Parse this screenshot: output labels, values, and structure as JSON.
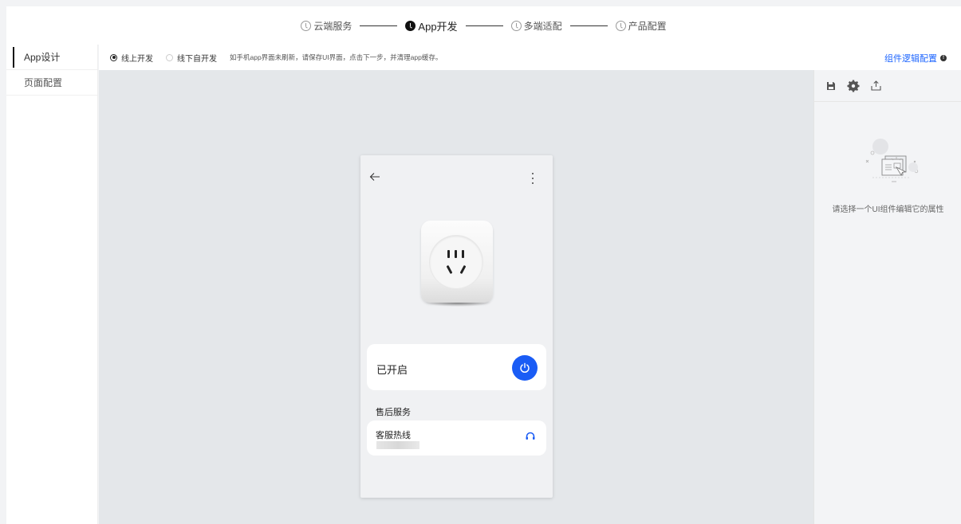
{
  "stepper": {
    "steps": [
      {
        "label": "云端服务",
        "active": false
      },
      {
        "label": "App开发",
        "active": true
      },
      {
        "label": "多端适配",
        "active": false
      },
      {
        "label": "产品配置",
        "active": false
      }
    ]
  },
  "leftnav": {
    "items": [
      {
        "label": "App设计",
        "active": true
      },
      {
        "label": "页面配置",
        "active": false
      }
    ]
  },
  "toolbar": {
    "online_label": "线上开发",
    "offline_label": "线下自开发",
    "hint": "如手机app界面未刷新，请保存UI界面，点击下一步，并清理app缓存。",
    "logic_link": "组件逻辑配置"
  },
  "phone": {
    "power_label": "已开启",
    "section_title": "售后服务",
    "hotline_label": "客服热线",
    "accent": "#1a5cf5"
  },
  "right_panel": {
    "empty_text": "请选择一个UI组件编辑它的属性"
  },
  "icons": [
    "back-arrow-icon",
    "more-icon",
    "power-icon",
    "headset-icon",
    "save-icon",
    "settings-icon",
    "export-icon",
    "info-icon"
  ]
}
